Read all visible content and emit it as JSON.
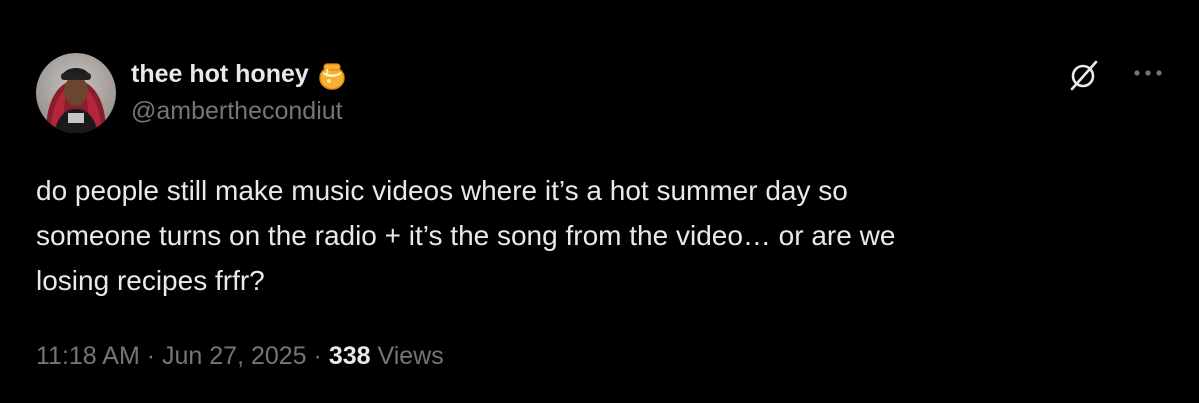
{
  "author": {
    "display_name": "thee hot honey",
    "handle": "@amberthecondiut",
    "emoji_icon": "honey-pot-icon",
    "avatar_icon": "profile-photo"
  },
  "tweet": {
    "text": "do people still make music videos where it’s a hot summer day so\nsomeone turns on the radio + it’s the song from the video… or are we\nlosing recipes frfr?"
  },
  "meta": {
    "time": "11:18 AM",
    "separator": "·",
    "date": "Jun 27, 2025",
    "views_count": "338",
    "views_label": "Views"
  },
  "actions": {
    "grok_icon": "grok-slash-icon",
    "more_icon": "more-dots-icon"
  },
  "colors": {
    "background": "#000000",
    "primary_text": "#e7e9ea",
    "secondary_text": "#71767b"
  }
}
